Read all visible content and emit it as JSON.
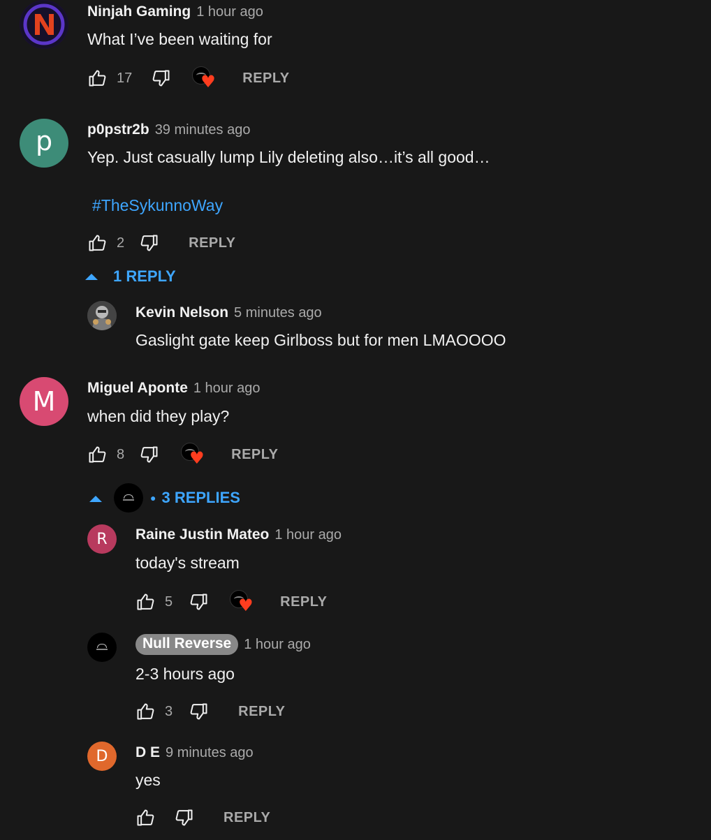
{
  "colors": {
    "background": "#181818",
    "link": "#3ea6ff",
    "heart": "#ff3d1f",
    "owner_badge": "#888888"
  },
  "comments": [
    {
      "author": "Ninjah Gaming",
      "time": "1 hour ago",
      "text": "What I’ve been waiting for",
      "likes": "17",
      "reply": "REPLY",
      "avatar_icon": "ninjah-n-logo-icon",
      "hearted": true
    },
    {
      "author": "p0pstr2b",
      "time": "39 minutes ago",
      "text": "Yep. Just casually lump Lily deleting also…it’s all good…",
      "hashtag": "#TheSykunnoWay",
      "likes": "2",
      "reply": "REPLY",
      "avatar_letter": "p",
      "avatar_color": "#3d8c78",
      "replies_toggle": "1 REPLY",
      "replies": [
        {
          "author": "Kevin Nelson",
          "time": "5 minutes ago",
          "text": "Gaslight gate keep Girlboss but for men LMAOOOO",
          "avatar_icon": "armored-character-avatar-icon"
        }
      ]
    },
    {
      "author": "Miguel Aponte",
      "time": "1 hour ago",
      "text": "when did they play?",
      "likes": "8",
      "reply": "REPLY",
      "avatar_letter": "M",
      "avatar_color": "#d84a72",
      "hearted": true,
      "replies_toggle": "3 REPLIES",
      "replies": [
        {
          "author": "Raine Justin Mateo",
          "time": "1 hour ago",
          "text": "today's stream",
          "likes": "5",
          "reply": "REPLY",
          "avatar_letter": "R",
          "avatar_color": "#b83a5e",
          "hearted": true
        },
        {
          "author": "Null Reverse",
          "time": "1 hour ago",
          "text": "2-3 hours ago",
          "likes": "3",
          "reply": "REPLY",
          "is_owner": true
        },
        {
          "author": "D E",
          "time": "9 minutes ago",
          "text": "yes",
          "likes": "",
          "reply": "REPLY",
          "avatar_letter": "D",
          "avatar_color": "#e0682c"
        }
      ]
    }
  ]
}
